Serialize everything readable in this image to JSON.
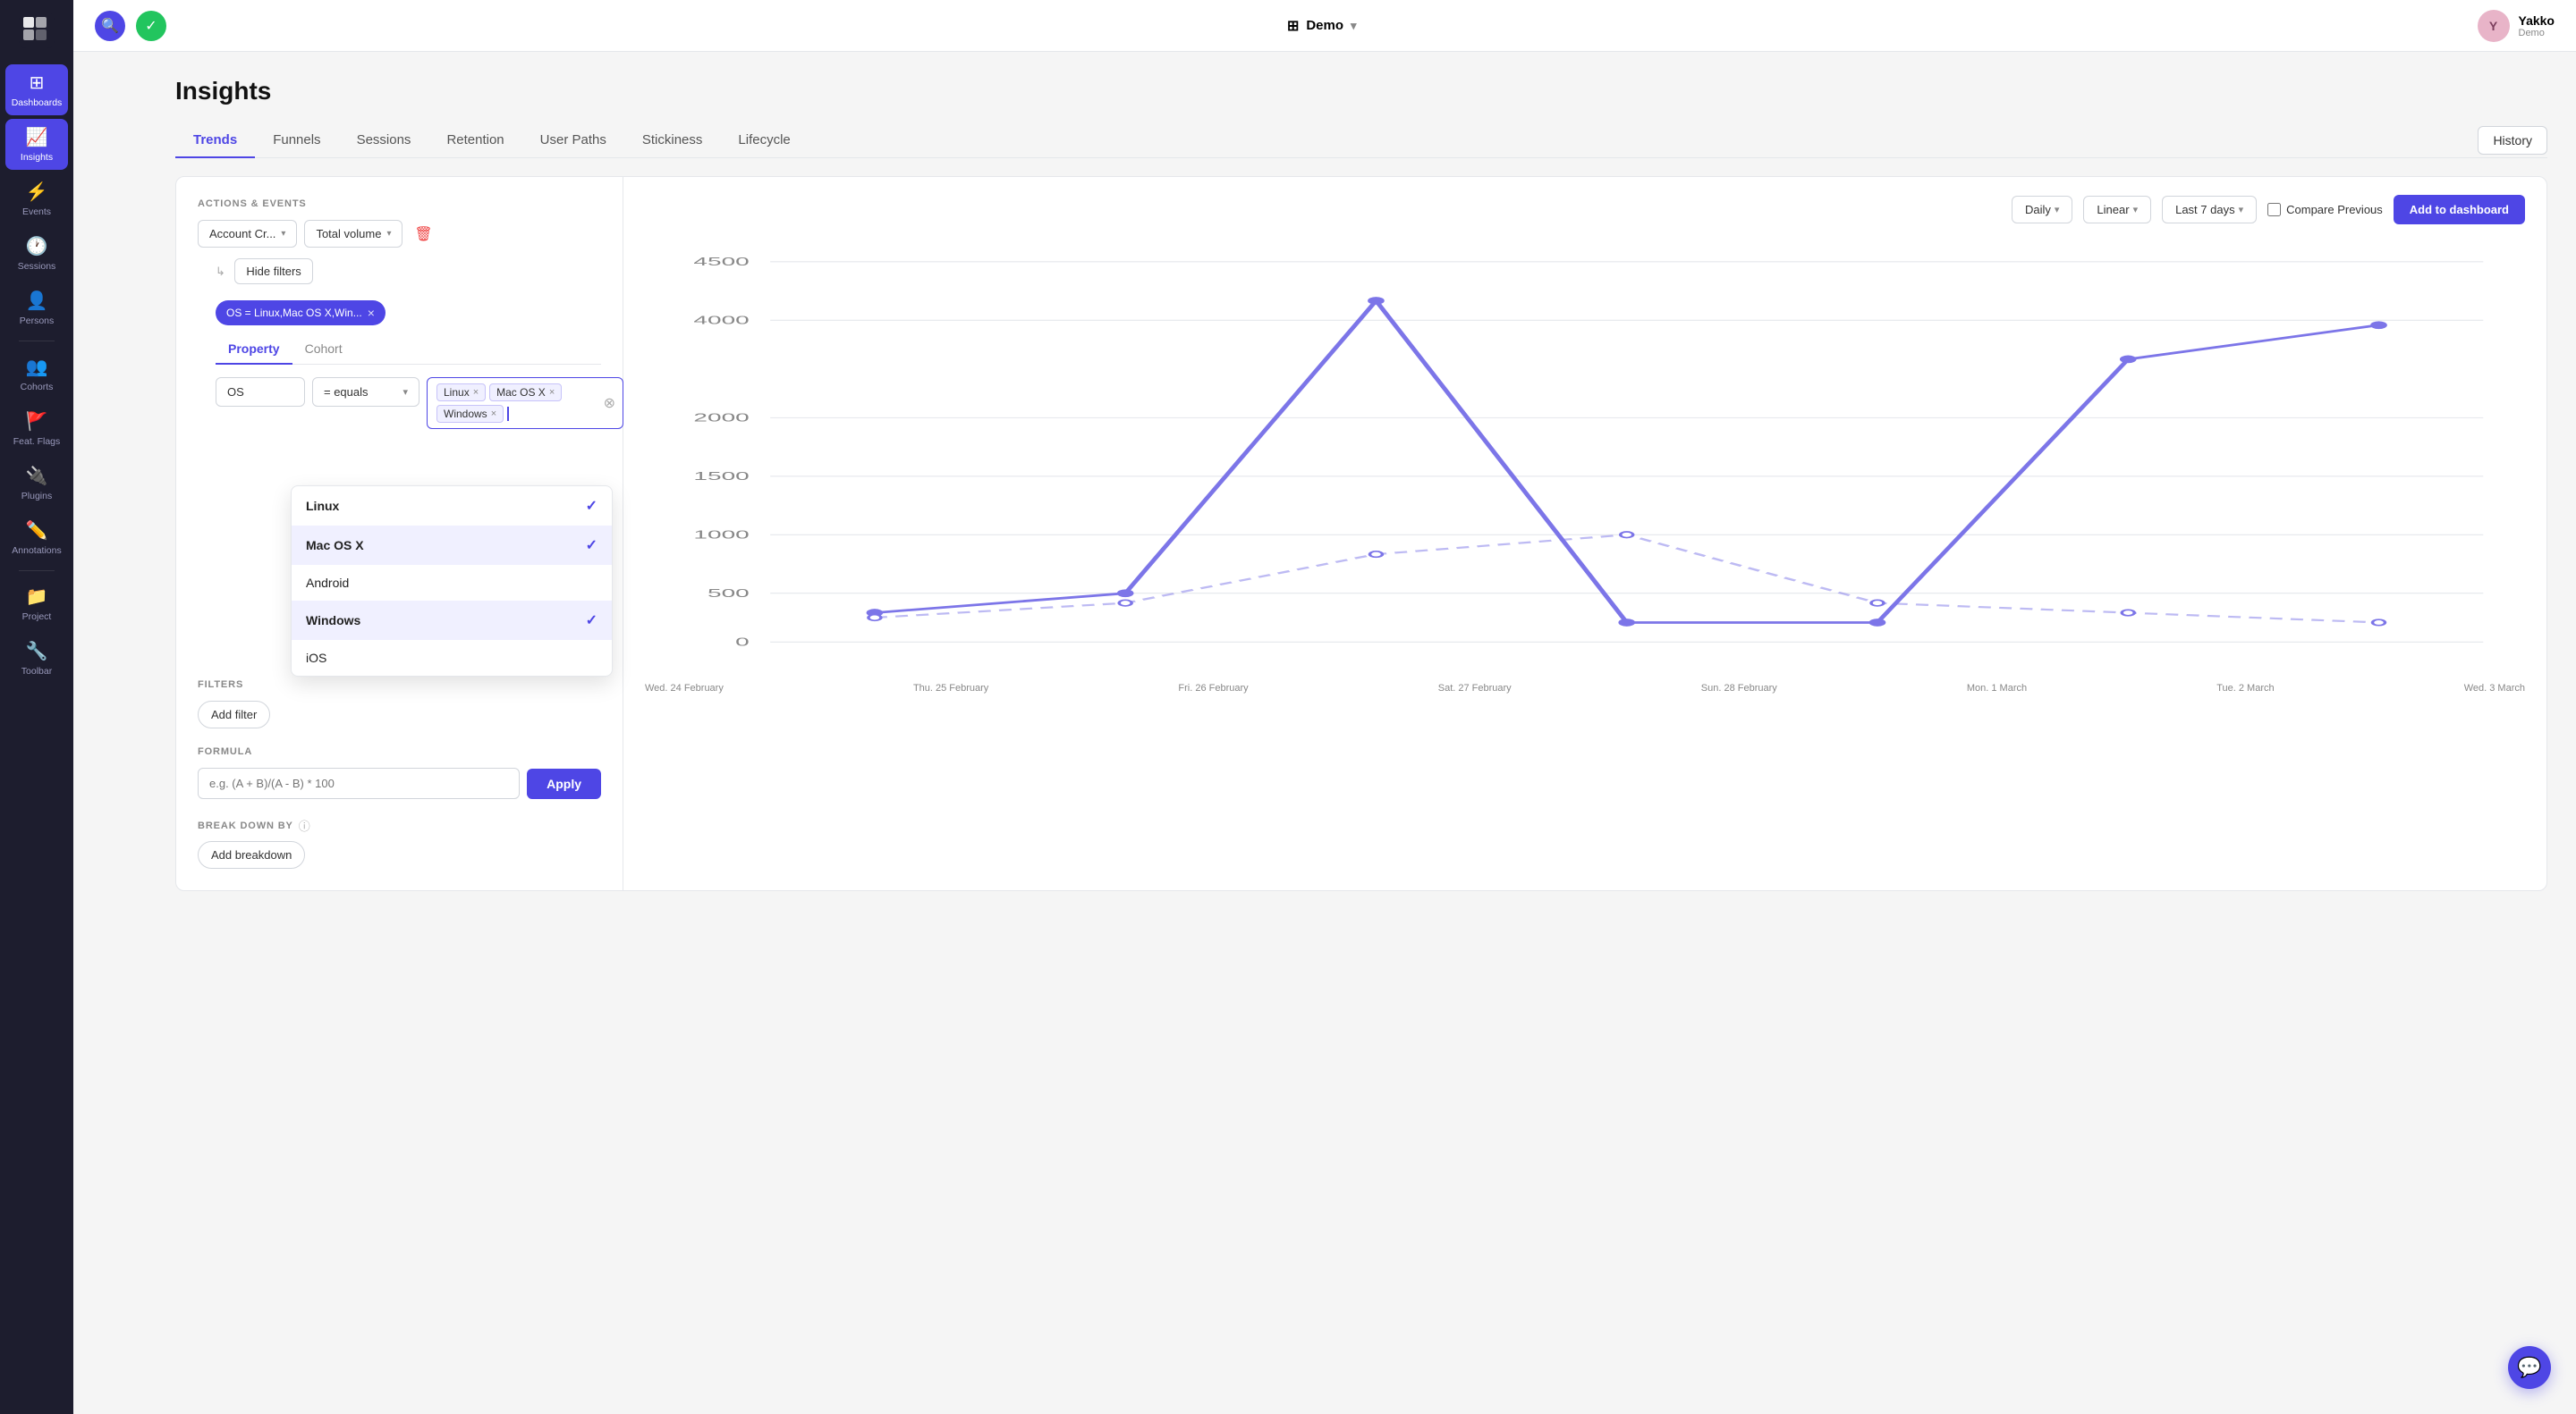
{
  "app": {
    "logo_alt": "PostHog logo",
    "workspace": "Demo",
    "workspace_chevron": "▾"
  },
  "topbar": {
    "search_icon": "🔍",
    "check_icon": "✓",
    "user_initial": "Y",
    "user_name": "Yakko",
    "user_role": "Demo"
  },
  "sidebar": {
    "items": [
      {
        "id": "dashboards",
        "label": "Dashboards",
        "icon": "⊞"
      },
      {
        "id": "insights",
        "label": "Insights",
        "icon": "📈",
        "active": true
      },
      {
        "id": "events",
        "label": "Events",
        "icon": "⚡"
      },
      {
        "id": "sessions",
        "label": "Sessions",
        "icon": "🕐"
      },
      {
        "id": "persons",
        "label": "Persons",
        "icon": "👤"
      },
      {
        "id": "cohorts",
        "label": "Cohorts",
        "icon": "👥"
      },
      {
        "id": "feat-flags",
        "label": "Feat. Flags",
        "icon": "🚩"
      },
      {
        "id": "plugins",
        "label": "Plugins",
        "icon": "🔌"
      },
      {
        "id": "annotations",
        "label": "Annotations",
        "icon": "✏️"
      },
      {
        "id": "project",
        "label": "Project",
        "icon": "📁"
      },
      {
        "id": "toolbar",
        "label": "Toolbar",
        "icon": "🔧"
      }
    ]
  },
  "page": {
    "title": "Insights"
  },
  "tabs": [
    {
      "id": "trends",
      "label": "Trends",
      "active": true
    },
    {
      "id": "funnels",
      "label": "Funnels"
    },
    {
      "id": "sessions",
      "label": "Sessions"
    },
    {
      "id": "retention",
      "label": "Retention"
    },
    {
      "id": "user-paths",
      "label": "User Paths"
    },
    {
      "id": "stickiness",
      "label": "Stickiness"
    },
    {
      "id": "lifecycle",
      "label": "Lifecycle"
    }
  ],
  "history_btn": "History",
  "left_panel": {
    "section_label": "ACTIONS & EVENTS",
    "event_dropdown": "Account Cr...",
    "metric_dropdown": "Total volume",
    "delete_icon": "🗑",
    "hide_filters_btn": "Hide filters",
    "filter_chip_label": "OS = Linux,Mac OS X,Win...",
    "prop_tab_property": "Property",
    "prop_tab_cohort": "Cohort",
    "filter_property": "OS",
    "filter_operator": "= equals",
    "filter_values": [
      "Linux",
      "Mac OS X",
      "Windows"
    ],
    "dropdown_options": [
      {
        "label": "Linux",
        "selected": true
      },
      {
        "label": "Mac OS X",
        "selected": true
      },
      {
        "label": "Android",
        "selected": false
      },
      {
        "label": "Windows",
        "selected": true
      },
      {
        "label": "iOS",
        "selected": false
      }
    ],
    "filters_section_label": "FI",
    "add_filter_btn": "Add filter",
    "formula_label": "FORMULA",
    "formula_placeholder": "e.g. (A + B)/(A - B) * 100",
    "apply_btn": "Apply",
    "breakdown_label": "BREAK DOWN BY",
    "breakdown_info": "ⓘ",
    "add_breakdown_btn": "Add breakdown"
  },
  "right_panel": {
    "daily_btn": "Daily",
    "linear_btn": "Linear",
    "date_range_btn": "Last 7 days",
    "compare_label": "Compare Previous",
    "add_dashboard_btn": "Add to dashboard",
    "y_axis_labels": [
      "4500",
      "4000",
      "2000",
      "1500",
      "1000",
      "500",
      "0"
    ],
    "x_axis_labels": [
      "Wed. 24 February",
      "Thu. 25 February",
      "Fri. 26 February",
      "Sat. 27 February",
      "Sun. 28 February",
      "Mon. 1 March",
      "Tue. 2 March",
      "Wed. 3 March"
    ]
  },
  "chat_icon": "💬"
}
